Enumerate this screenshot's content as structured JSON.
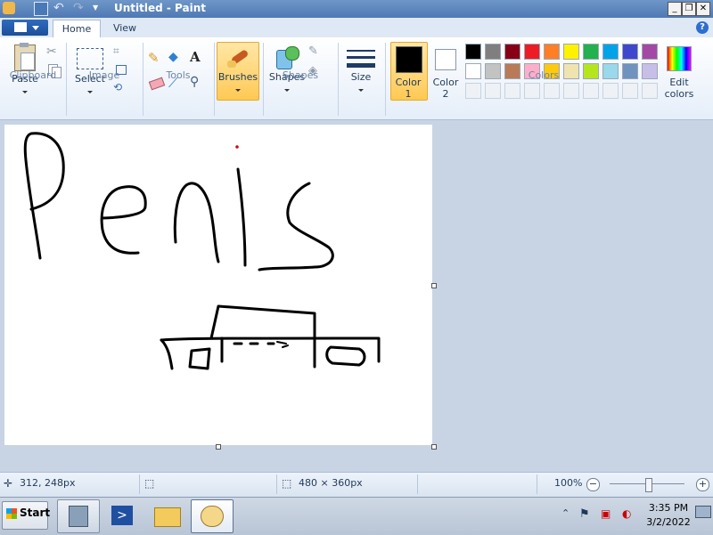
{
  "window": {
    "title": "Untitled - Paint",
    "controls": {
      "minimize": "_",
      "restore": "❐",
      "close": "✕"
    }
  },
  "ribbon": {
    "tabs": [
      {
        "label": "Home"
      },
      {
        "label": "View"
      }
    ],
    "help": "?",
    "groups": {
      "clipboard": {
        "label": "Clipboard",
        "paste_label": "Paste"
      },
      "image": {
        "label": "Image",
        "select_label": "Select"
      },
      "tools": {
        "label": "Tools"
      },
      "brushes": {
        "label": "Brushes"
      },
      "shapes": {
        "label": "Shapes",
        "shapes_label": "Shapes"
      },
      "size": {
        "label": "Size"
      },
      "colors": {
        "label": "Colors",
        "color1_label": "Color\n1",
        "color1_line1": "Color",
        "color1_line2": "1",
        "color2_line1": "Color",
        "color2_line2": "2",
        "color1_value": "#000000",
        "color2_value": "#ffffff",
        "edit_line1": "Edit",
        "edit_line2": "colors",
        "palette_row1": [
          "#000000",
          "#7f7f7f",
          "#880015",
          "#ed1c24",
          "#ff7f27",
          "#fff200",
          "#22b14c",
          "#00a2e8",
          "#3f48cc",
          "#a349a4"
        ],
        "palette_row2": [
          "#ffffff",
          "#c3c3c3",
          "#b97a57",
          "#ffaec9",
          "#ffc90e",
          "#efe4b0",
          "#b5e61d",
          "#99d9ea",
          "#7092be",
          "#c8bfe7"
        ]
      }
    }
  },
  "canvas": {
    "drawing_text": "Penis"
  },
  "status": {
    "cursor_pos": "312, 248px",
    "canvas_size": "480 × 360px",
    "zoom": "100%",
    "zoom_out": "−",
    "zoom_in": "+"
  },
  "taskbar": {
    "start_label": "Start",
    "clock_time": "3:35 PM",
    "clock_date": "3/2/2022"
  }
}
